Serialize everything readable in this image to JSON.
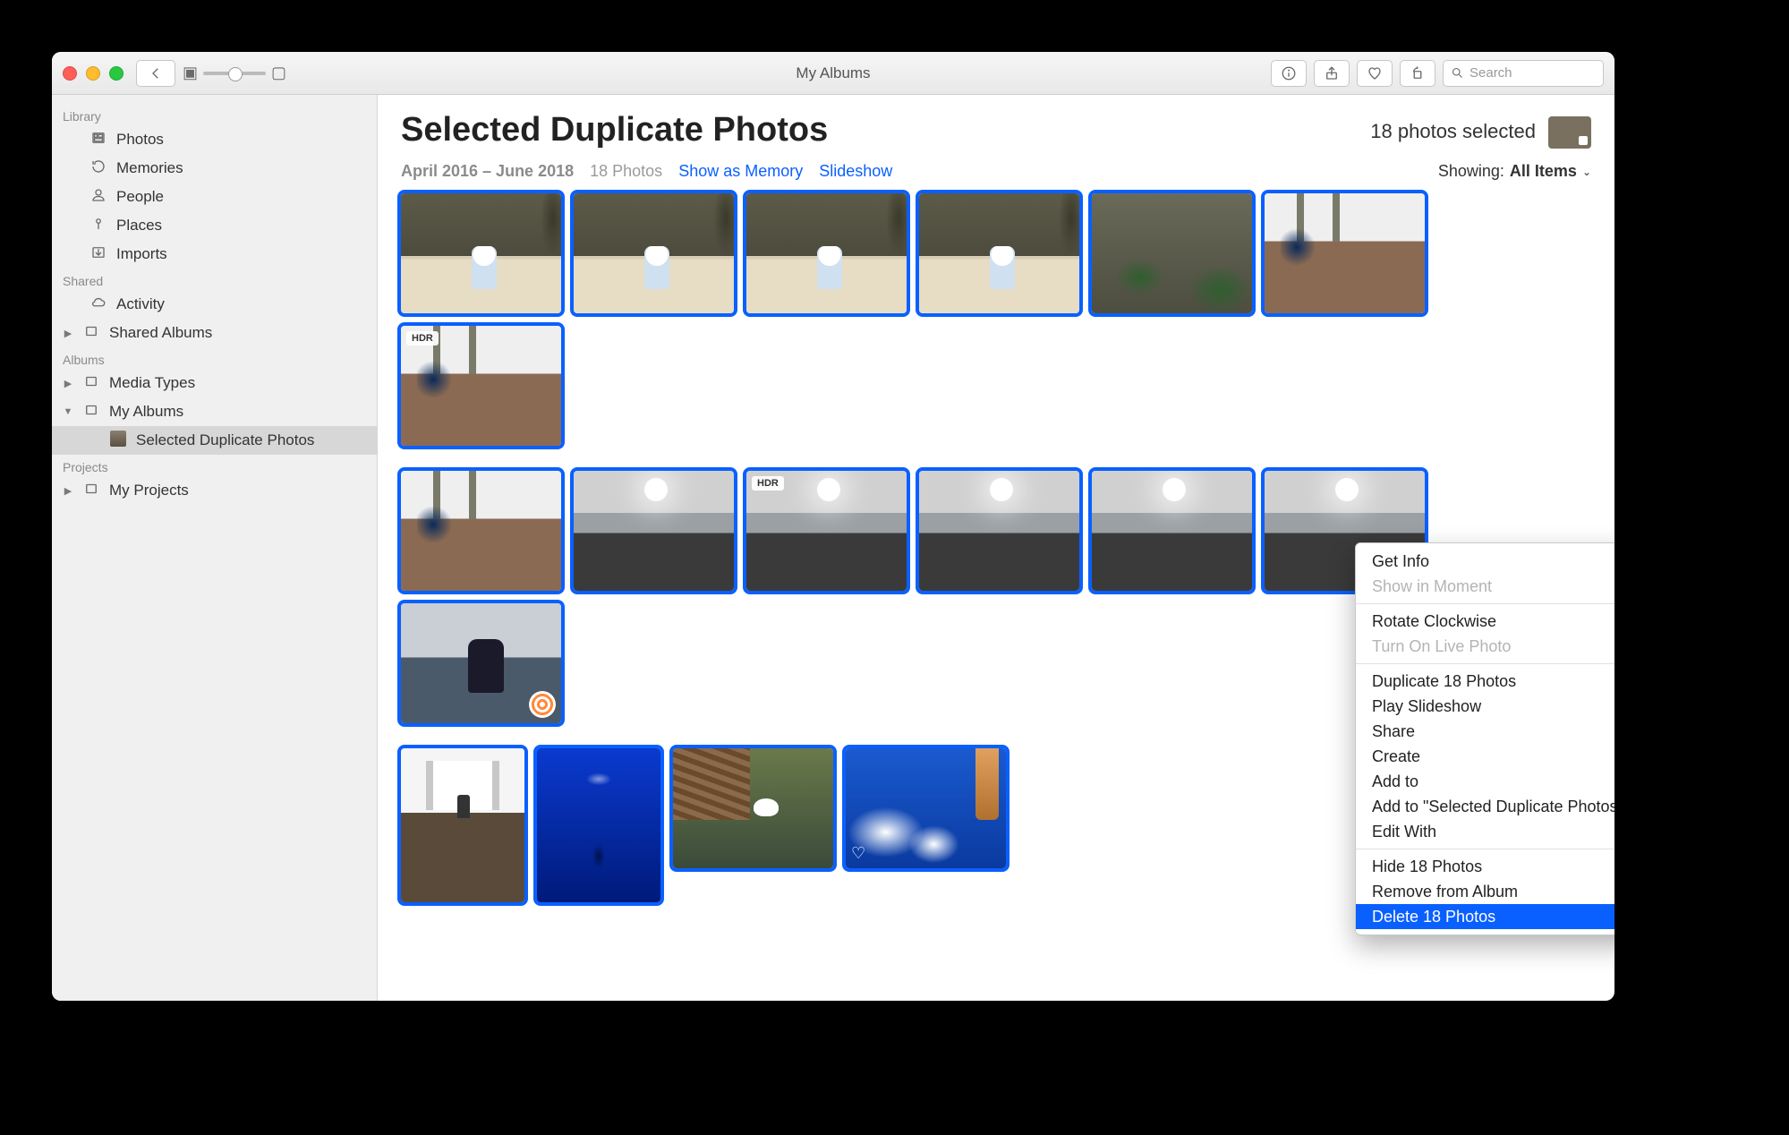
{
  "window_title": "My Albums",
  "toolbar": {
    "search_placeholder": "Search"
  },
  "sidebar": {
    "sections": [
      {
        "label": "Library",
        "items": [
          {
            "label": "Photos",
            "icon": "photos"
          },
          {
            "label": "Memories",
            "icon": "memories"
          },
          {
            "label": "People",
            "icon": "people"
          },
          {
            "label": "Places",
            "icon": "places"
          },
          {
            "label": "Imports",
            "icon": "imports"
          }
        ]
      },
      {
        "label": "Shared",
        "items": [
          {
            "label": "Activity",
            "icon": "cloud"
          },
          {
            "label": "Shared Albums",
            "icon": "album",
            "disclosure": "right"
          }
        ]
      },
      {
        "label": "Albums",
        "items": [
          {
            "label": "Media Types",
            "icon": "album",
            "disclosure": "right"
          },
          {
            "label": "My Albums",
            "icon": "album",
            "disclosure": "down",
            "children": [
              {
                "label": "Selected Duplicate Photos",
                "icon": "photo-thumb",
                "selected": true
              }
            ]
          }
        ]
      },
      {
        "label": "Projects",
        "items": [
          {
            "label": "My Projects",
            "icon": "album",
            "disclosure": "right"
          }
        ]
      }
    ]
  },
  "content": {
    "title": "Selected Duplicate Photos",
    "selected_count_text": "18 photos selected",
    "date_range": "April 2016 – June 2018",
    "photo_count": "18 Photos",
    "link_memory": "Show as Memory",
    "link_slideshow": "Slideshow",
    "showing_label": "Showing:",
    "showing_value": "All Items",
    "thumbs": [
      {
        "style": "beach"
      },
      {
        "style": "beach"
      },
      {
        "style": "beach"
      },
      {
        "style": "beach"
      },
      {
        "style": "rockwall"
      },
      {
        "style": "peacock"
      },
      {
        "style": "peacock",
        "badge": "HDR"
      },
      {
        "style": "peacock"
      },
      {
        "style": "seasun"
      },
      {
        "style": "seasun",
        "badge": "HDR"
      },
      {
        "style": "seasun"
      },
      {
        "style": "seasun"
      },
      {
        "style": "seasun"
      },
      {
        "style": "sailor"
      },
      {
        "style": "stairs",
        "tall": true
      },
      {
        "style": "aquarium",
        "tall": true
      },
      {
        "style": "swan"
      },
      {
        "style": "skycloud",
        "heart": true
      }
    ]
  },
  "context_menu": {
    "items": [
      {
        "label": "Get Info"
      },
      {
        "label": "Show in Moment",
        "disabled": true
      },
      {
        "sep": true
      },
      {
        "label": "Rotate Clockwise"
      },
      {
        "label": "Turn On Live Photo",
        "disabled": true
      },
      {
        "sep": true
      },
      {
        "label": "Duplicate 18 Photos"
      },
      {
        "label": "Play Slideshow"
      },
      {
        "label": "Share",
        "submenu": true
      },
      {
        "label": "Create",
        "submenu": true
      },
      {
        "label": "Add to",
        "submenu": true
      },
      {
        "label": "Add to \"Selected Duplicate Photos\""
      },
      {
        "label": "Edit With",
        "submenu": true
      },
      {
        "sep": true
      },
      {
        "label": "Hide 18 Photos"
      },
      {
        "label": "Remove from Album"
      },
      {
        "label": "Delete 18 Photos",
        "highlight": true
      }
    ]
  }
}
